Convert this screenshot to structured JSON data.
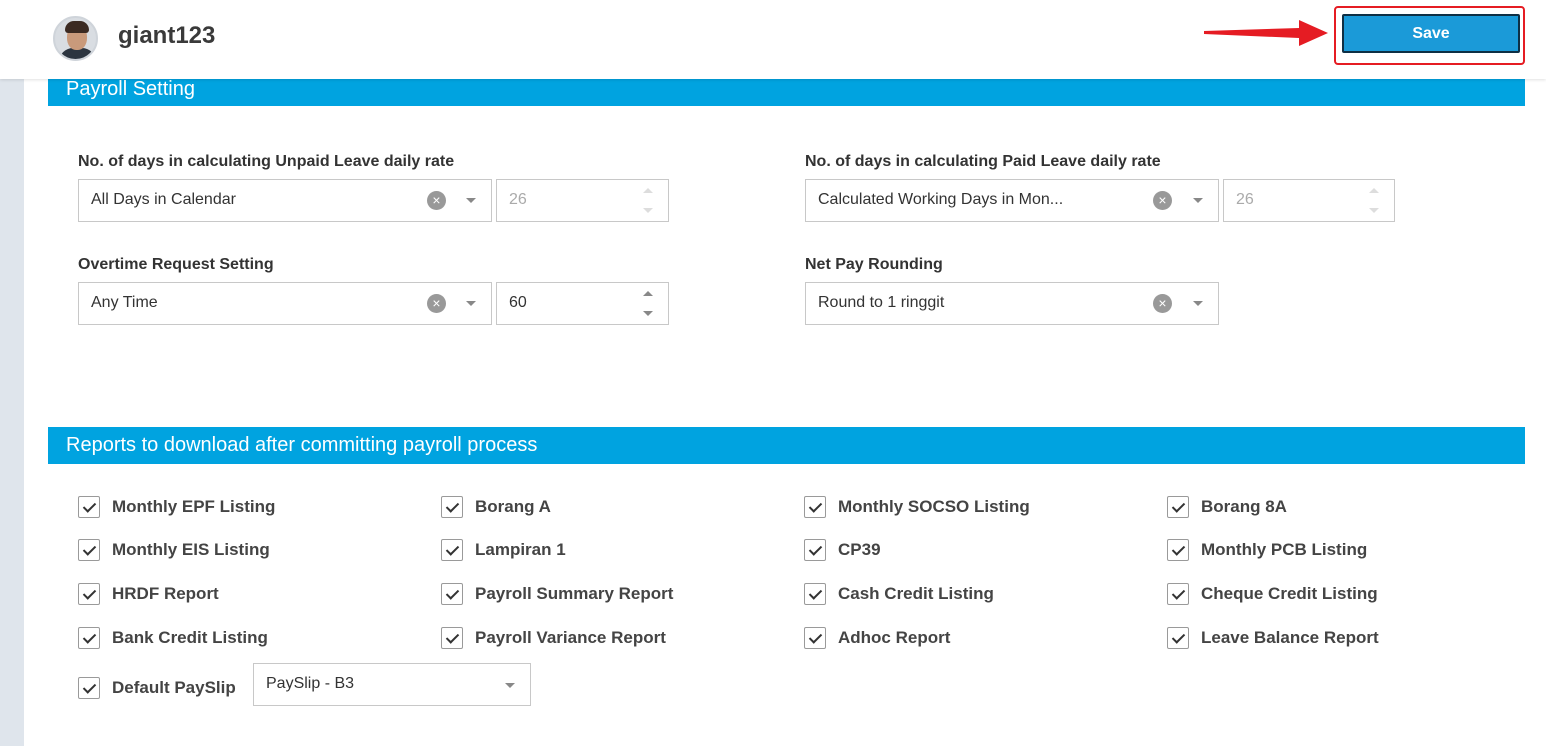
{
  "header": {
    "username": "giant123",
    "save_label": "Save"
  },
  "sections": {
    "payroll_setting": "Payroll Setting",
    "reports": "Reports to download after committing payroll process"
  },
  "payroll": {
    "unpaid_leave": {
      "label": "No. of days in calculating Unpaid Leave daily rate",
      "selected": "All Days in Calendar",
      "days": "26"
    },
    "paid_leave": {
      "label": "No. of days in calculating Paid Leave daily rate",
      "selected": "Calculated Working Days in Mon...",
      "days": "26"
    },
    "overtime": {
      "label": "Overtime Request Setting",
      "selected": "Any Time",
      "value": "60"
    },
    "net_pay": {
      "label": "Net Pay Rounding",
      "selected": "Round to 1 ringgit"
    }
  },
  "reports": [
    {
      "label": "Monthly EPF Listing",
      "checked": true
    },
    {
      "label": "Borang A",
      "checked": true
    },
    {
      "label": "Monthly SOCSO Listing",
      "checked": true
    },
    {
      "label": "Borang 8A",
      "checked": true
    },
    {
      "label": "Monthly EIS Listing",
      "checked": true
    },
    {
      "label": "Lampiran 1",
      "checked": true
    },
    {
      "label": "CP39",
      "checked": true
    },
    {
      "label": "Monthly PCB Listing",
      "checked": true
    },
    {
      "label": "HRDF Report",
      "checked": true
    },
    {
      "label": "Payroll Summary Report",
      "checked": true
    },
    {
      "label": "Cash Credit Listing",
      "checked": true
    },
    {
      "label": "Cheque Credit Listing",
      "checked": true
    },
    {
      "label": "Bank Credit Listing",
      "checked": true
    },
    {
      "label": "Payroll Variance Report",
      "checked": true
    },
    {
      "label": "Adhoc Report",
      "checked": true
    },
    {
      "label": "Leave Balance Report",
      "checked": true
    }
  ],
  "payslip": {
    "label": "Default PaySlip",
    "checked": true,
    "selected": "PaySlip - B3"
  },
  "icons": {
    "clear": "clear-circle-icon",
    "caret": "chevron-down-icon",
    "check": "checkmark-icon",
    "arrow": "red-arrow-annotation"
  },
  "colors": {
    "accent": "#00a3e0",
    "save_button": "#1b9ad8",
    "annotation": "#e51c23"
  }
}
